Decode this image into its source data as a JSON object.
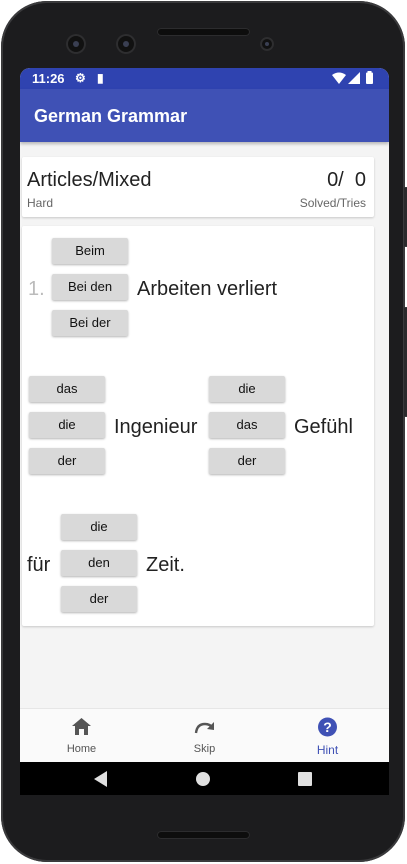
{
  "status_bar": {
    "time": "11:26"
  },
  "app_bar": {
    "title": "German Grammar"
  },
  "header": {
    "category": "Articles/Mixed",
    "difficulty": "Hard",
    "solved": "0/",
    "tries": "0",
    "score_label": "Solved/Tries"
  },
  "quiz": {
    "q1": {
      "number": "1.",
      "options": [
        "Beim",
        "Bei den",
        "Bei der"
      ],
      "text": "Arbeiten verliert"
    },
    "q2": {
      "options_a": [
        "das",
        "die",
        "der"
      ],
      "word_a": "Ingenieur",
      "options_b": [
        "die",
        "das",
        "der"
      ],
      "word_b": "Gefühl"
    },
    "q3": {
      "prefix": "für",
      "options": [
        "die",
        "den",
        "der"
      ],
      "suffix": "Zeit."
    }
  },
  "bottom_nav": {
    "items": [
      {
        "label": "Home",
        "icon": "home-icon"
      },
      {
        "label": "Skip",
        "icon": "redo-arrow-icon"
      },
      {
        "label": "Hint",
        "icon": "help-circle-icon"
      }
    ],
    "active": "Hint",
    "active_color": "#3f51b5"
  },
  "colors": {
    "app_bar": "#3f51b5",
    "status_bar": "#2f43b0"
  }
}
